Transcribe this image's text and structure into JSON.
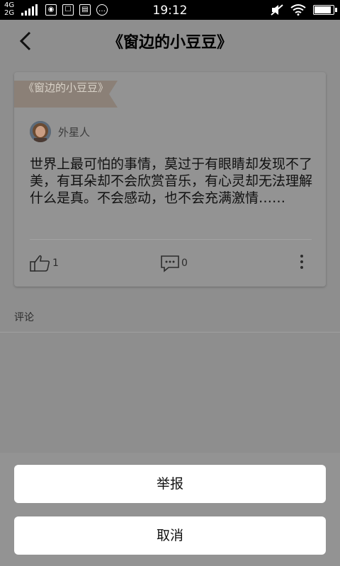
{
  "status_bar": {
    "network_top": "4G",
    "network_bottom": "2G",
    "time": "19:12",
    "battery_level": 0.9
  },
  "header": {
    "title": "《窗边的小豆豆》"
  },
  "card": {
    "ribbon_text": "《窗边的小豆豆》",
    "author": "外星人",
    "content": "世界上最可怕的事情，莫过于有眼睛却发现不了美，有耳朵却不会欣赏音乐，有心灵却无法理解什么是真。不会感动，也不会充满激情……",
    "like_count": "1",
    "comment_count": "0"
  },
  "comments": {
    "label": "评论"
  },
  "action_sheet": {
    "report_label": "举报",
    "cancel_label": "取消"
  },
  "colors": {
    "overlay": "#8e8e8e",
    "ribbon": "#8b8077",
    "sheet_button": "#ffffff"
  }
}
